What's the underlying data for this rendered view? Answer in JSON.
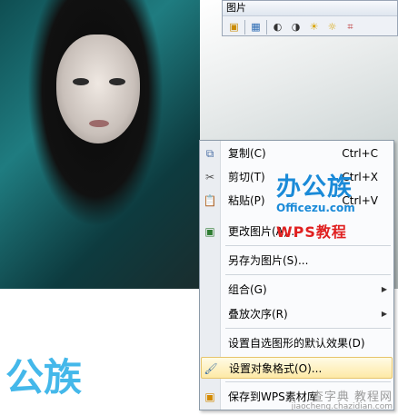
{
  "toolbar": {
    "title": "图片",
    "buttons": [
      {
        "name": "insert-picture-icon",
        "glyph": "▣"
      },
      {
        "name": "color-icon",
        "glyph": "▦"
      },
      {
        "name": "more-contrast-icon",
        "glyph": "◐"
      },
      {
        "name": "less-contrast-icon",
        "glyph": "◑"
      },
      {
        "name": "more-brightness-icon",
        "glyph": "☀"
      },
      {
        "name": "less-brightness-icon",
        "glyph": "☼"
      },
      {
        "name": "crop-icon",
        "glyph": "⌗"
      }
    ]
  },
  "context_menu": {
    "items": [
      {
        "label": "复制(C)",
        "shortcut": "Ctrl+C"
      },
      {
        "label": "剪切(T)",
        "shortcut": "Ctrl+X"
      },
      {
        "label": "粘贴(P)",
        "shortcut": "Ctrl+V"
      },
      {
        "label": "更改图片(A)..."
      },
      {
        "label": "另存为图片(S)..."
      },
      {
        "label": "组合(G)"
      },
      {
        "label": "叠放次序(R)"
      },
      {
        "label": "设置自选图形的默认效果(D)"
      },
      {
        "label": "设置对象格式(O)..."
      },
      {
        "label": "保存到WPS素材库"
      }
    ]
  },
  "watermarks": {
    "brand_chars": "办公族",
    "domain": "Officezu.com",
    "wps_tutorial": "WPS教程",
    "big_logo": "公族",
    "bottom_site": "查字典 教程网",
    "bottom_url": "jiaocheng.chazidian.com"
  }
}
